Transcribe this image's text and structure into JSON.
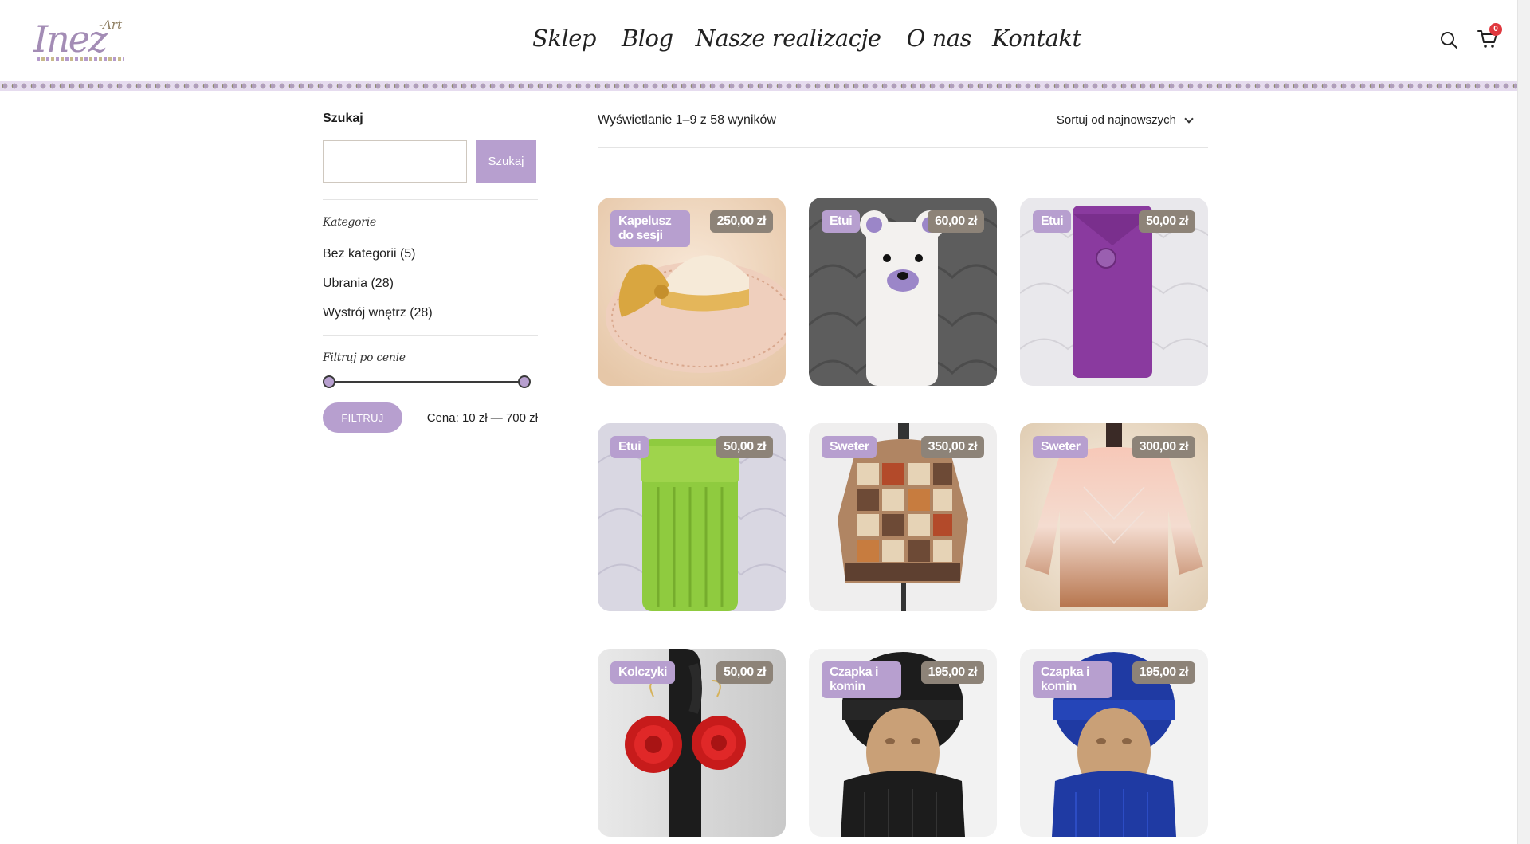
{
  "brand": {
    "logo_main": "Inez",
    "logo_sub": "-Art"
  },
  "nav": [
    "Sklep",
    "Blog",
    "Nasze realizacje",
    "O nas",
    "Kontakt"
  ],
  "cart": {
    "count": "0"
  },
  "sidebar": {
    "search_title": "Szukaj",
    "search_placeholder": "",
    "search_button": "Szukaj",
    "categories_title": "Kategorie",
    "categories": [
      "Bez kategorii (5)",
      "Ubrania (28)",
      "Wystrój wnętrz (28)"
    ],
    "price_title": "Filtruj po cenie",
    "filter_button": "FILTRUJ",
    "price_range_label": "Cena: 10 zł — 700 zł",
    "price_min": 10,
    "price_max": 700
  },
  "main": {
    "result_count": "Wyświetlanie 1–9 z 58 wyników",
    "sort_label": "Sortuj od najnowszych"
  },
  "products": [
    {
      "tag": "Kapelusz do sesji",
      "price": "250,00 zł"
    },
    {
      "tag": "Etui",
      "price": "60,00 zł"
    },
    {
      "tag": "Etui",
      "price": "50,00 zł"
    },
    {
      "tag": "Etui",
      "price": "50,00 zł"
    },
    {
      "tag": "Sweter",
      "price": "350,00 zł"
    },
    {
      "tag": "Sweter",
      "price": "300,00 zł"
    },
    {
      "tag": "Kolczyki",
      "price": "50,00 zł"
    },
    {
      "tag": "Czapka i komin",
      "price": "195,00 zł"
    },
    {
      "tag": "Czapka i komin",
      "price": "195,00 zł"
    }
  ],
  "colors": {
    "accent": "#b79fcf",
    "price_badge": "#8d8378",
    "cart_badge": "#e0383e"
  }
}
